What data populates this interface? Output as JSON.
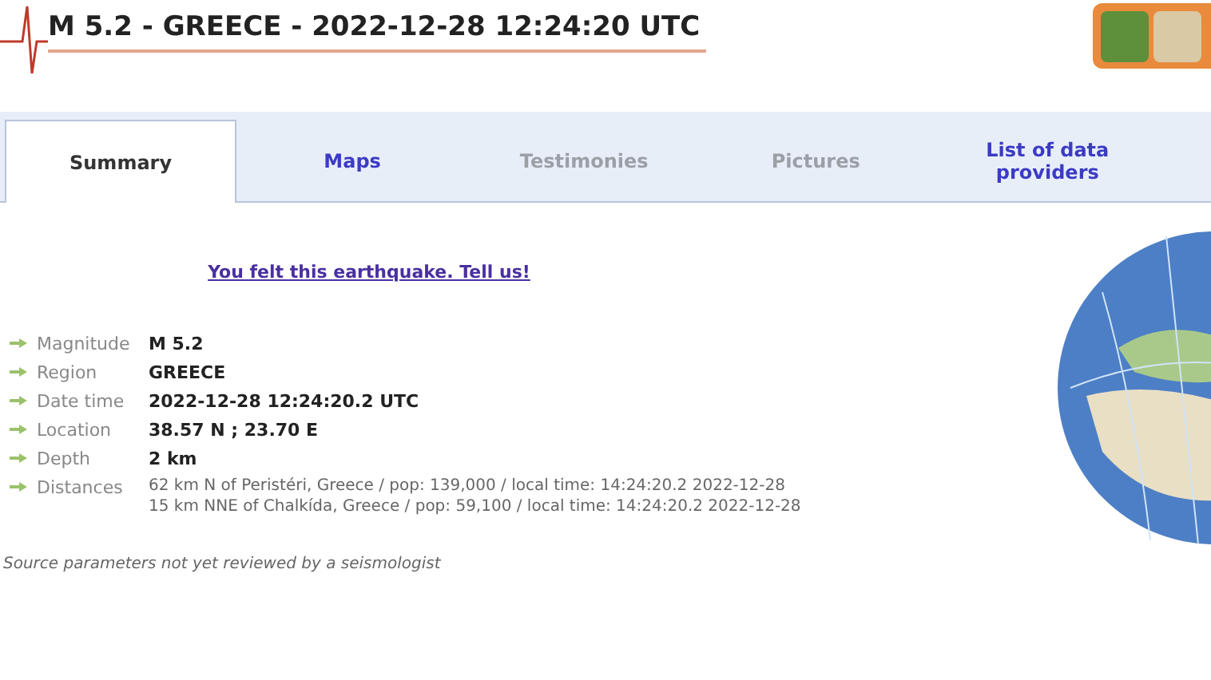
{
  "header": {
    "title": "M 5.2 - GREECE - 2022-12-28 12:24:20 UTC"
  },
  "tabs": [
    {
      "label": "Summary",
      "selected": true,
      "disabled": false
    },
    {
      "label": "Maps",
      "selected": false,
      "disabled": false
    },
    {
      "label": "Testimonies",
      "selected": false,
      "disabled": true
    },
    {
      "label": "Pictures",
      "selected": false,
      "disabled": true
    },
    {
      "label": "List of data providers",
      "selected": false,
      "disabled": false
    }
  ],
  "felt_link": "You felt this earthquake. Tell us!",
  "details": [
    {
      "label": "Magnitude",
      "values": [
        "M 5.2"
      ],
      "bold": true
    },
    {
      "label": "Region",
      "values": [
        "GREECE"
      ],
      "bold": true
    },
    {
      "label": "Date time",
      "values": [
        "2022-12-28 12:24:20.2 UTC"
      ],
      "bold": true
    },
    {
      "label": "Location",
      "values": [
        "38.57 N ; 23.70 E"
      ],
      "bold": true
    },
    {
      "label": "Depth",
      "values": [
        "2 km"
      ],
      "bold": true
    },
    {
      "label": "Distances",
      "values": [
        "62 km N of Peristéri, Greece / pop: 139,000 / local time: 14:24:20.2 2022-12-28",
        "15 km NNE of Chalkída, Greece / pop: 59,100 / local time: 14:24:20.2 2022-12-28"
      ],
      "bold": false
    }
  ],
  "note": "Source parameters not yet reviewed by a seismologist"
}
